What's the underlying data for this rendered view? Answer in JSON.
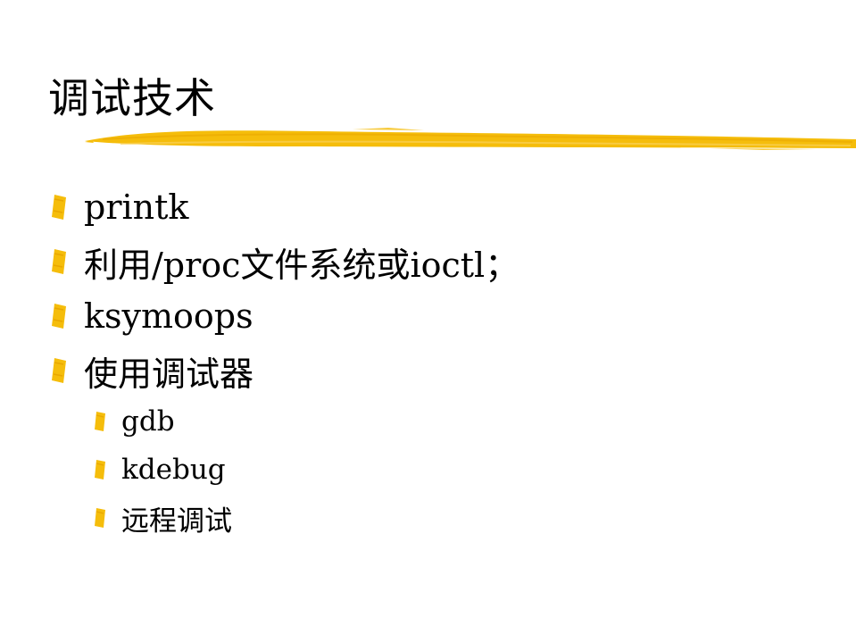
{
  "slide": {
    "title": "调试技术",
    "accent_color": "#f5bd0b",
    "bullets": [
      {
        "text": "printk",
        "level": 1
      },
      {
        "text": "利用/proc文件系统或ioctl；",
        "level": 1
      },
      {
        "text": "ksymoops",
        "level": 1
      },
      {
        "text": "使用调试器",
        "level": 1
      },
      {
        "text": "gdb",
        "level": 2
      },
      {
        "text": "kdebug",
        "level": 2
      },
      {
        "text": "远程调试",
        "level": 2
      }
    ]
  }
}
